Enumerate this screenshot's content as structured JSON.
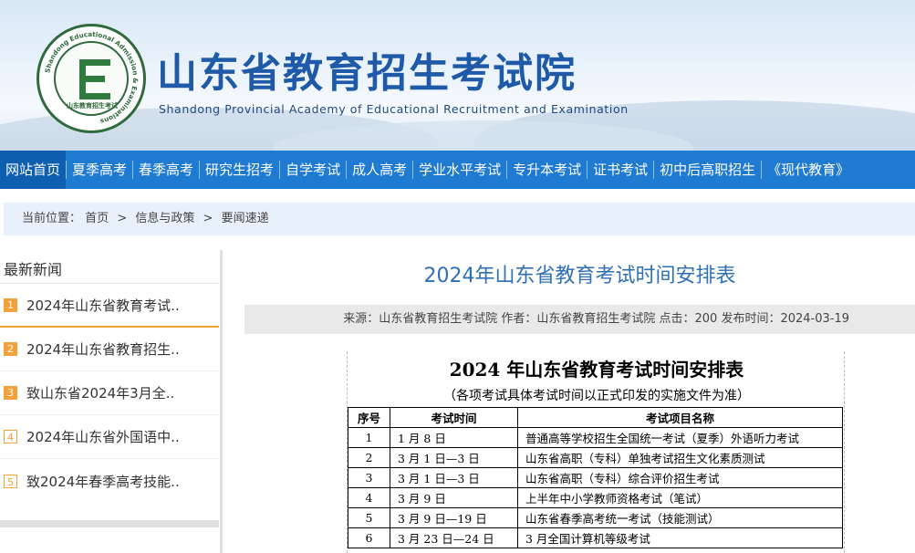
{
  "header": {
    "title_cn": "山东省教育招生考试院",
    "title_en": "Shandong Provincial Academy of Educational Recruitment and Examination",
    "logo_ring_text": "Shandong Educational Admission & Examinations",
    "logo_cn": "山东教育招生考试",
    "logo_letter": "E"
  },
  "nav": {
    "items": [
      "网站首页",
      "夏季高考",
      "春季高考",
      "研究生招考",
      "自学考试",
      "成人高考",
      "学业水平考试",
      "专升本考试",
      "证书考试",
      "初中后高职招生",
      "《现代教育》"
    ]
  },
  "breadcrumb": {
    "prefix": "当前位置：",
    "items": [
      "首页",
      "信息与政策",
      "要闻速递"
    ],
    "sep": ">"
  },
  "sidebar": {
    "title": "最新新闻",
    "items": [
      {
        "num": "1",
        "label": "2024年山东省教育考试.."
      },
      {
        "num": "2",
        "label": "2024年山东省教育招生.."
      },
      {
        "num": "3",
        "label": "致山东省2024年3月全.."
      },
      {
        "num": "4",
        "label": "2024年山东省外国语中.."
      },
      {
        "num": "5",
        "label": "致2024年春季高考技能.."
      }
    ]
  },
  "article": {
    "title": "2024年山东省教育考试时间安排表",
    "meta": "来源：山东省教育招生考试院 作者：山东省教育招生考试院 点击：200 发布时间：2024-03-19",
    "doc_title": "2024 年山东省教育考试时间安排表",
    "doc_note": "（各项考试具体考试时间以正式印发的实施文件为准）",
    "table": {
      "headers": [
        "序号",
        "考试时间",
        "考试项目名称"
      ],
      "rows": [
        [
          "1",
          "1 月 8 日",
          "普通高等学校招生全国统一考试（夏季）外语听力考试"
        ],
        [
          "2",
          "3 月 1 日—3 日",
          "山东省高职（专科）单独考试招生文化素质测试"
        ],
        [
          "3",
          "3 月 1 日—3 日",
          "山东省高职（专科）综合评价招生考试"
        ],
        [
          "4",
          "3 月 9 日",
          "上半年中小学教师资格考试（笔试）"
        ],
        [
          "5",
          "3 月 9 日—19 日",
          "山东省春季高考统一考试（技能测试）"
        ],
        [
          "6",
          "3 月 23 日—24 日",
          "3 月全国计算机等级考试"
        ]
      ]
    }
  },
  "colors": {
    "nav_bg": "#1f7ad2",
    "title_blue": "#2f6fb6",
    "accent_orange": "#f3a13b",
    "logo_green": "#2f7a3d"
  }
}
